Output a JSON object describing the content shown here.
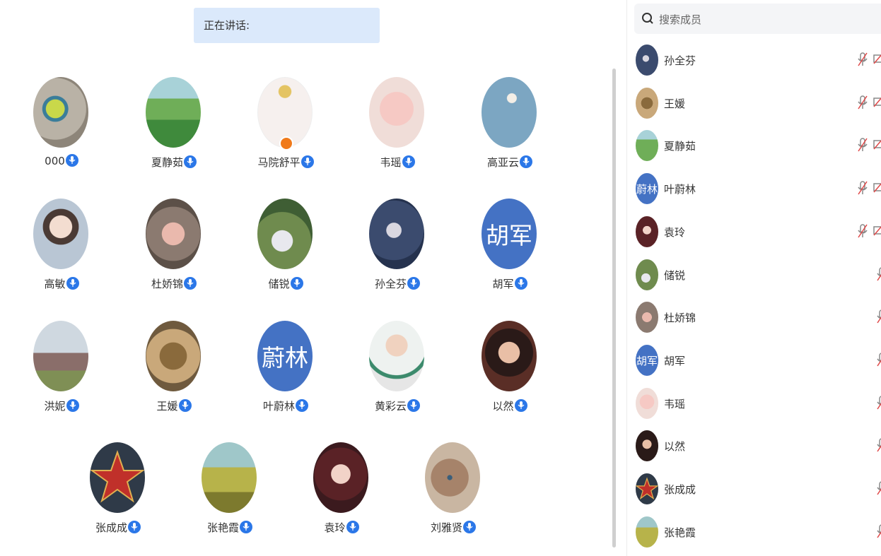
{
  "speaking": {
    "label": "正在讲话:"
  },
  "participants": [
    {
      "name": "000"
    },
    {
      "name": "夏静茹"
    },
    {
      "name": "马院舒平",
      "host": true
    },
    {
      "name": "韦瑶"
    },
    {
      "name": "高亚云"
    },
    {
      "name": "高敏"
    },
    {
      "name": "杜娇锦"
    },
    {
      "name": "储锐"
    },
    {
      "name": "孙全芬"
    },
    {
      "name": "胡军",
      "avatar_text": "胡军"
    },
    {
      "name": "洪妮"
    },
    {
      "name": "王媛"
    },
    {
      "name": "叶蔚林",
      "avatar_text": "蔚林"
    },
    {
      "name": "黄彩云"
    },
    {
      "name": "以然"
    },
    {
      "name": "张成成"
    },
    {
      "name": "张艳霞"
    },
    {
      "name": "袁玲"
    },
    {
      "name": "刘雅贤"
    }
  ],
  "search": {
    "placeholder": "搜索成员"
  },
  "members": [
    {
      "name": "孙全芬",
      "mic": "muted",
      "camera": "off"
    },
    {
      "name": "王媛",
      "mic": "muted",
      "camera": "off"
    },
    {
      "name": "夏静茹",
      "mic": "muted",
      "camera": "off"
    },
    {
      "name": "叶蔚林",
      "avatar_text": "蔚林",
      "mic": "muted",
      "camera": "off"
    },
    {
      "name": "袁玲",
      "mic": "muted",
      "camera": "off"
    },
    {
      "name": "储锐",
      "mic": "muted"
    },
    {
      "name": "杜娇锦",
      "mic": "muted"
    },
    {
      "name": "胡军",
      "avatar_text": "胡军",
      "mic": "muted"
    },
    {
      "name": "韦瑶",
      "mic": "muted"
    },
    {
      "name": "以然",
      "mic": "muted"
    },
    {
      "name": "张成成",
      "mic": "muted"
    },
    {
      "name": "张艳霞",
      "mic": "muted"
    }
  ],
  "colors": {
    "accent": "#2b77e8",
    "text_avatar": "#4472c4",
    "speaking_bg": "#dbe9fb",
    "host_badge": "#f07a1a"
  }
}
